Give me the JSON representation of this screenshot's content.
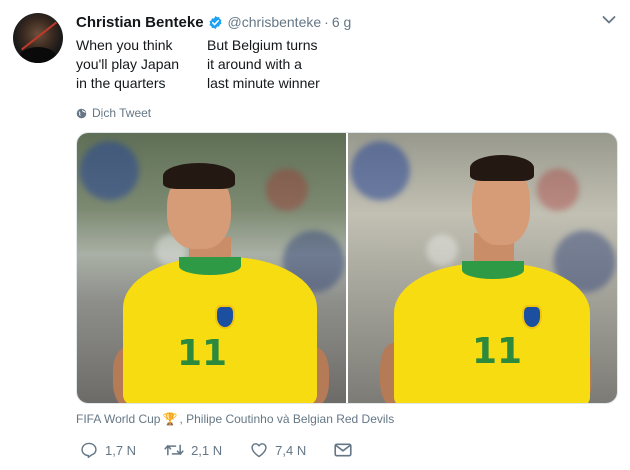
{
  "author": {
    "display_name": "Christian Benteke",
    "handle": "@chrisbenteke",
    "separator": "·",
    "time": "6 g"
  },
  "tweet": {
    "left_lines": [
      "When you think",
      "you'll play Japan",
      "in the quarters"
    ],
    "right_lines": [
      "But Belgium turns",
      "it around with a",
      "last minute winner"
    ]
  },
  "translate": {
    "label": "Dịch Tweet"
  },
  "media": {
    "photo_one_number": "11",
    "photo_two_number": "11"
  },
  "meta": {
    "event": "FIFA World Cup",
    "trophy": "🏆",
    "tags": ", Philipe Coutinho và Belgian Red Devils"
  },
  "actions": {
    "replies": "1,7 N",
    "retweets": "2,1 N",
    "likes": "7,4 N"
  },
  "colors": {
    "verified": "#1da1f2",
    "secondary_text": "#657786",
    "jersey": "#f7dc12",
    "jersey_trim": "#2f9a45"
  }
}
